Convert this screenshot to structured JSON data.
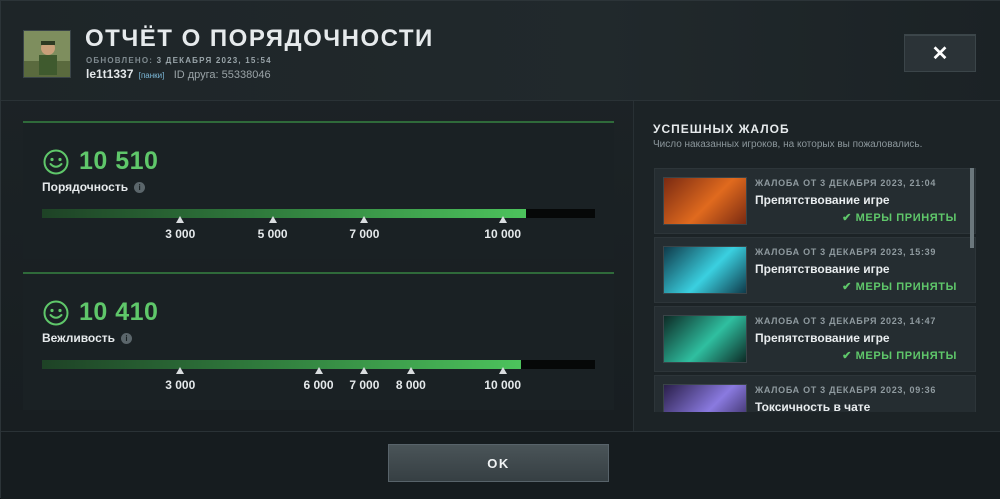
{
  "header": {
    "title": "ОТЧЁТ О ПОРЯДОЧНОСТИ",
    "updated_label": "ОБНОВЛЕНО:",
    "updated_value": "3 ДЕКАБРЯ 2023, 15:54",
    "nickname": "le1t1337",
    "tag": "[панки]",
    "friend_id": "ID друга: 55338046",
    "close_icon": "close-icon"
  },
  "metrics": [
    {
      "icon": "smiley-icon",
      "score": "10 510",
      "label": "Порядочность",
      "progress_fraction": 0.875,
      "ticks": [
        {
          "label": "3 000",
          "fraction": 0.25
        },
        {
          "label": "5 000",
          "fraction": 0.417
        },
        {
          "label": "7 000",
          "fraction": 0.583
        },
        {
          "label": "10 000",
          "fraction": 0.833
        }
      ]
    },
    {
      "icon": "smiley-icon",
      "score": "10 410",
      "label": "Вежливость",
      "progress_fraction": 0.867,
      "ticks": [
        {
          "label": "3 000",
          "fraction": 0.25
        },
        {
          "label": "6 000",
          "fraction": 0.5
        },
        {
          "label": "7 000",
          "fraction": 0.583
        },
        {
          "label": "8 000",
          "fraction": 0.667
        },
        {
          "label": "10 000",
          "fraction": 0.833
        }
      ]
    }
  ],
  "reports": {
    "title": "УСПЕШНЫХ ЖАЛОБ",
    "subtitle": "Число наказанных игроков, на которых вы пожаловались.",
    "items": [
      {
        "date": "ЖАЛОБА ОТ 3 ДЕКАБРЯ 2023, 21:04",
        "type": "Препятствование игре",
        "status": "МЕРЫ ПРИНЯТЫ",
        "hero_colors": [
          "#7a2a12",
          "#e06a1e"
        ]
      },
      {
        "date": "ЖАЛОБА ОТ 3 ДЕКАБРЯ 2023, 15:39",
        "type": "Препятствование игре",
        "status": "МЕРЫ ПРИНЯТЫ",
        "hero_colors": [
          "#0f3a4a",
          "#3ad0e0"
        ]
      },
      {
        "date": "ЖАЛОБА ОТ 3 ДЕКАБРЯ 2023, 14:47",
        "type": "Препятствование игре",
        "status": "МЕРЫ ПРИНЯТЫ",
        "hero_colors": [
          "#0d2b26",
          "#2fbfa0"
        ]
      },
      {
        "date": "ЖАЛОБА ОТ 3 ДЕКАБРЯ 2023, 09:36",
        "type": "Токсичность в чате",
        "status": "",
        "hero_colors": [
          "#2a1f4a",
          "#8a7ae0"
        ]
      }
    ]
  },
  "footer": {
    "ok_label": "OK"
  },
  "colors": {
    "accent_green": "#5fc76a",
    "bar_track": "#060808"
  }
}
